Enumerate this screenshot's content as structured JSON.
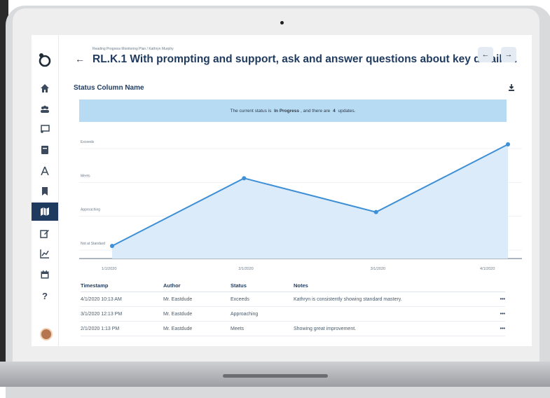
{
  "header": {
    "breadcrumb": "Reading Progress Monitoring Plan / Kathryn Murphy",
    "title": "RL.K.1 With prompting and support, ask and answer questions about key details...",
    "prev_label": "←",
    "next_label": "→"
  },
  "sidebar": {
    "items": [
      {
        "name": "home-icon",
        "active": false
      },
      {
        "name": "students-icon",
        "active": false
      },
      {
        "name": "classroom-icon",
        "active": false
      },
      {
        "name": "notebook-icon",
        "active": false
      },
      {
        "name": "geometry-icon",
        "active": false
      },
      {
        "name": "bookmark-icon",
        "active": false
      },
      {
        "name": "map-icon",
        "active": true
      },
      {
        "name": "edit-icon",
        "active": false
      },
      {
        "name": "chart-icon",
        "active": false
      },
      {
        "name": "calendar-icon",
        "active": false
      },
      {
        "name": "help-icon",
        "active": false
      }
    ]
  },
  "card": {
    "title": "Status Column Name",
    "banner": {
      "prefix": "The current status is",
      "status": "In Progress",
      "middle": ", and there are",
      "count": "4",
      "suffix": "updates."
    }
  },
  "chart_data": {
    "type": "area",
    "title": "",
    "xlabel": "",
    "ylabel": "",
    "y_categories": [
      "Not at Standard",
      "Approaching",
      "Meets",
      "Exceeds"
    ],
    "x": [
      "1/1/2020",
      "2/1/2020",
      "3/1/2020",
      "4/1/2020"
    ],
    "series": [
      {
        "values": [
          "Not at Standard",
          "Meets",
          "Approaching",
          "Exceeds"
        ]
      }
    ],
    "ylim": [
      "Not at Standard",
      "Exceeds"
    ],
    "grid": true,
    "line_color": "#3d8fd6",
    "fill_color": "#dcebfa"
  },
  "table": {
    "headers": [
      "Timestamp",
      "Author",
      "Status",
      "Notes"
    ],
    "rows": [
      {
        "timestamp": "4/1/2020 10:13 AM",
        "author": "Mr. Eastdude",
        "status": "Exceeds",
        "notes": "Kathryn is consistently showing standard mastery.",
        "menu": "•••"
      },
      {
        "timestamp": "3/1/2020 12:13 PM",
        "author": "Mr. Eastdude",
        "status": "Approaching",
        "notes": "",
        "menu": "•••"
      },
      {
        "timestamp": "2/1/2020 1:13 PM",
        "author": "Mr. Eastdude",
        "status": "Meets",
        "notes": "Showing great improvement.",
        "menu": "•••"
      }
    ]
  },
  "colors": {
    "accent": "#1f3a5f",
    "banner": "#b8dbf4",
    "line": "#3d8fd6"
  }
}
